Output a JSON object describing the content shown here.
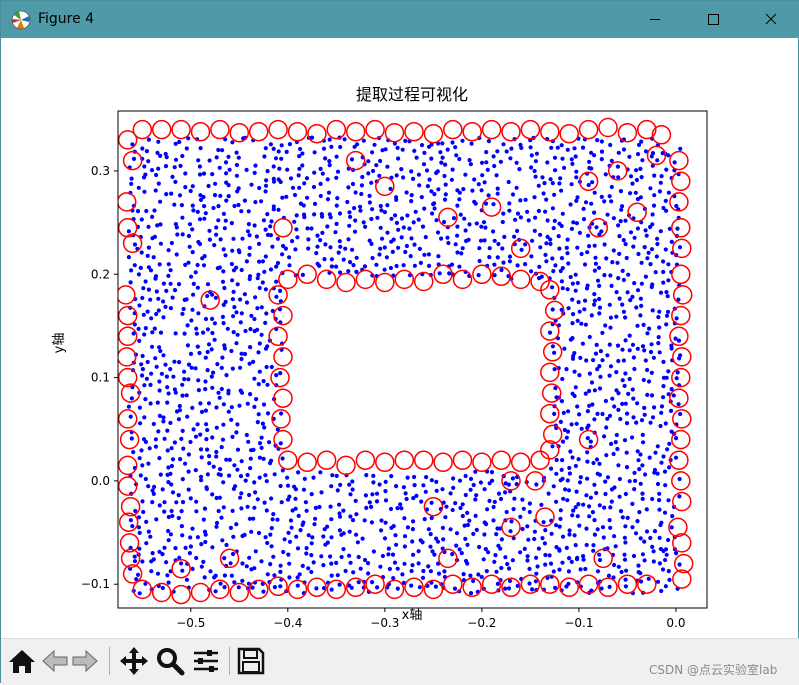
{
  "window": {
    "title": "Figure 4",
    "controls": [
      "minimize-icon",
      "maximize-icon",
      "close-icon"
    ]
  },
  "toolbar": {
    "buttons": [
      "home-icon",
      "back-icon",
      "forward-icon",
      "pan-icon",
      "zoom-icon",
      "configure-subplots-icon",
      "save-icon"
    ]
  },
  "watermark": "CSDN @点云实验室lab",
  "chart_data": {
    "type": "scatter",
    "title": "提取过程可视化",
    "xlabel": "x轴",
    "ylabel": "y轴",
    "xlim": [
      -0.575,
      0.032
    ],
    "ylim": [
      -0.123,
      0.358
    ],
    "xticks": [
      -0.5,
      -0.4,
      -0.3,
      -0.2,
      -0.1,
      0.0
    ],
    "xtick_labels": [
      "−0.5",
      "−0.4",
      "−0.3",
      "−0.2",
      "−0.1",
      "0.0"
    ],
    "yticks": [
      -0.1,
      0.0,
      0.1,
      0.2,
      0.3
    ],
    "ytick_labels": [
      "−0.1",
      "0.0",
      "0.1",
      "0.2",
      "0.3"
    ],
    "grid": false,
    "legend": null,
    "series": [
      {
        "marker": "filled-dot",
        "color": "#0000ff",
        "description_region": {
          "outer_x": [
            -0.56,
            0.005
          ],
          "outer_y": [
            -0.105,
            0.335
          ],
          "hole_x": [
            -0.405,
            -0.13
          ],
          "hole_y": [
            0.01,
            0.195
          ]
        }
      },
      {
        "marker": "hollow-circle",
        "color": "#ff0000",
        "points": [
          [
            -0.565,
            0.33
          ],
          [
            -0.56,
            0.31
          ],
          [
            -0.566,
            0.27
          ],
          [
            -0.565,
            0.245
          ],
          [
            -0.56,
            0.23
          ],
          [
            -0.567,
            0.18
          ],
          [
            -0.565,
            0.16
          ],
          [
            -0.565,
            0.14
          ],
          [
            -0.566,
            0.12
          ],
          [
            -0.565,
            0.1
          ],
          [
            -0.562,
            0.085
          ],
          [
            -0.565,
            0.06
          ],
          [
            -0.563,
            0.04
          ],
          [
            -0.565,
            0.015
          ],
          [
            -0.565,
            -0.005
          ],
          [
            -0.562,
            -0.025
          ],
          [
            -0.564,
            -0.04
          ],
          [
            -0.563,
            -0.06
          ],
          [
            -0.562,
            -0.075
          ],
          [
            -0.56,
            -0.09
          ],
          [
            -0.55,
            0.34
          ],
          [
            -0.53,
            0.34
          ],
          [
            -0.51,
            0.34
          ],
          [
            -0.49,
            0.338
          ],
          [
            -0.47,
            0.34
          ],
          [
            -0.45,
            0.337
          ],
          [
            -0.43,
            0.338
          ],
          [
            -0.41,
            0.34
          ],
          [
            -0.39,
            0.338
          ],
          [
            -0.37,
            0.336
          ],
          [
            -0.35,
            0.34
          ],
          [
            -0.33,
            0.338
          ],
          [
            -0.31,
            0.34
          ],
          [
            -0.29,
            0.337
          ],
          [
            -0.27,
            0.338
          ],
          [
            -0.25,
            0.336
          ],
          [
            -0.23,
            0.34
          ],
          [
            -0.21,
            0.338
          ],
          [
            -0.19,
            0.34
          ],
          [
            -0.17,
            0.338
          ],
          [
            -0.15,
            0.34
          ],
          [
            -0.13,
            0.338
          ],
          [
            -0.11,
            0.336
          ],
          [
            -0.09,
            0.34
          ],
          [
            -0.07,
            0.342
          ],
          [
            -0.05,
            0.337
          ],
          [
            -0.03,
            0.34
          ],
          [
            -0.015,
            0.335
          ],
          [
            -0.55,
            -0.105
          ],
          [
            -0.53,
            -0.108
          ],
          [
            -0.51,
            -0.11
          ],
          [
            -0.49,
            -0.108
          ],
          [
            -0.47,
            -0.105
          ],
          [
            -0.45,
            -0.108
          ],
          [
            -0.43,
            -0.105
          ],
          [
            -0.41,
            -0.102
          ],
          [
            -0.39,
            -0.105
          ],
          [
            -0.37,
            -0.103
          ],
          [
            -0.35,
            -0.105
          ],
          [
            -0.33,
            -0.103
          ],
          [
            -0.31,
            -0.1
          ],
          [
            -0.29,
            -0.105
          ],
          [
            -0.27,
            -0.103
          ],
          [
            -0.25,
            -0.105
          ],
          [
            -0.23,
            -0.1
          ],
          [
            -0.21,
            -0.103
          ],
          [
            -0.19,
            -0.1
          ],
          [
            -0.17,
            -0.103
          ],
          [
            -0.15,
            -0.1
          ],
          [
            -0.13,
            -0.1
          ],
          [
            -0.11,
            -0.103
          ],
          [
            -0.09,
            -0.1
          ],
          [
            -0.07,
            -0.103
          ],
          [
            -0.05,
            -0.1
          ],
          [
            -0.03,
            -0.1
          ],
          [
            0.003,
            0.31
          ],
          [
            0.005,
            0.29
          ],
          [
            0.003,
            0.27
          ],
          [
            0.005,
            0.245
          ],
          [
            0.006,
            0.225
          ],
          [
            0.005,
            0.2
          ],
          [
            0.007,
            0.18
          ],
          [
            0.005,
            0.16
          ],
          [
            0.003,
            0.14
          ],
          [
            0.006,
            0.12
          ],
          [
            0.005,
            0.1
          ],
          [
            0.003,
            0.08
          ],
          [
            0.006,
            0.06
          ],
          [
            0.005,
            0.04
          ],
          [
            0.003,
            0.02
          ],
          [
            0.005,
            0.0
          ],
          [
            0.006,
            -0.02
          ],
          [
            0.002,
            -0.045
          ],
          [
            0.006,
            -0.06
          ],
          [
            0.008,
            -0.08
          ],
          [
            0.006,
            -0.095
          ],
          [
            -0.4,
            0.195
          ],
          [
            -0.38,
            0.2
          ],
          [
            -0.36,
            0.195
          ],
          [
            -0.34,
            0.192
          ],
          [
            -0.32,
            0.195
          ],
          [
            -0.3,
            0.192
          ],
          [
            -0.28,
            0.195
          ],
          [
            -0.26,
            0.193
          ],
          [
            -0.24,
            0.2
          ],
          [
            -0.22,
            0.195
          ],
          [
            -0.2,
            0.2
          ],
          [
            -0.18,
            0.198
          ],
          [
            -0.16,
            0.195
          ],
          [
            -0.14,
            0.193
          ],
          [
            -0.4,
            0.02
          ],
          [
            -0.38,
            0.018
          ],
          [
            -0.36,
            0.02
          ],
          [
            -0.34,
            0.015
          ],
          [
            -0.32,
            0.02
          ],
          [
            -0.3,
            0.018
          ],
          [
            -0.28,
            0.02
          ],
          [
            -0.26,
            0.02
          ],
          [
            -0.24,
            0.018
          ],
          [
            -0.22,
            0.02
          ],
          [
            -0.2,
            0.018
          ],
          [
            -0.18,
            0.02
          ],
          [
            -0.16,
            0.018
          ],
          [
            -0.14,
            0.02
          ],
          [
            -0.41,
            0.18
          ],
          [
            -0.405,
            0.16
          ],
          [
            -0.41,
            0.14
          ],
          [
            -0.405,
            0.12
          ],
          [
            -0.408,
            0.1
          ],
          [
            -0.405,
            0.08
          ],
          [
            -0.407,
            0.06
          ],
          [
            -0.405,
            0.04
          ],
          [
            -0.13,
            0.185
          ],
          [
            -0.125,
            0.165
          ],
          [
            -0.13,
            0.145
          ],
          [
            -0.127,
            0.125
          ],
          [
            -0.13,
            0.105
          ],
          [
            -0.128,
            0.085
          ],
          [
            -0.13,
            0.065
          ],
          [
            -0.127,
            0.045
          ],
          [
            -0.13,
            0.03
          ],
          [
            -0.405,
            0.245
          ],
          [
            -0.48,
            0.175
          ],
          [
            -0.33,
            0.31
          ],
          [
            -0.3,
            0.285
          ],
          [
            -0.235,
            0.255
          ],
          [
            -0.19,
            0.265
          ],
          [
            -0.16,
            0.225
          ],
          [
            -0.09,
            0.29
          ],
          [
            -0.06,
            0.3
          ],
          [
            -0.08,
            0.245
          ],
          [
            -0.04,
            0.26
          ],
          [
            -0.02,
            0.315
          ],
          [
            -0.09,
            0.04
          ],
          [
            -0.17,
            0.0
          ],
          [
            -0.145,
            0.0
          ],
          [
            -0.25,
            -0.025
          ],
          [
            -0.235,
            -0.075
          ],
          [
            -0.17,
            -0.045
          ],
          [
            -0.135,
            -0.035
          ],
          [
            -0.51,
            -0.085
          ],
          [
            -0.46,
            -0.075
          ],
          [
            -0.075,
            -0.075
          ]
        ]
      }
    ]
  }
}
